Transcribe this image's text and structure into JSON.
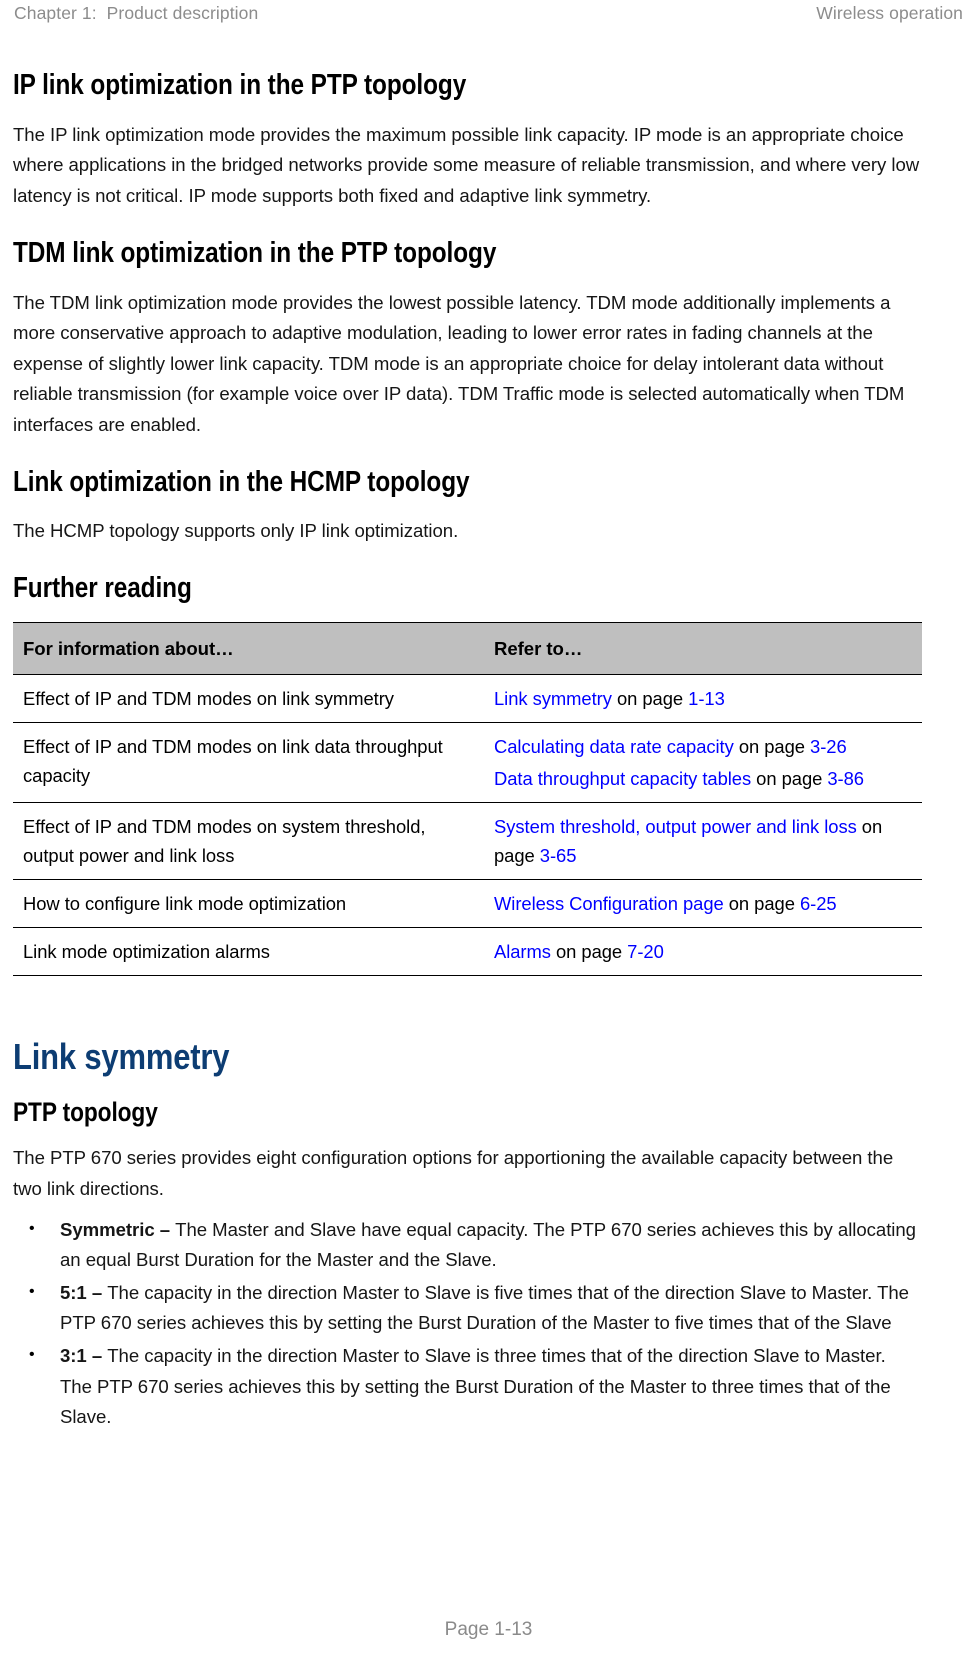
{
  "runhead": {
    "left": "Chapter 1:  Product description",
    "right": "Wireless operation"
  },
  "sections": {
    "ip": {
      "heading": "IP link optimization in the PTP topology",
      "body": "The IP link optimization mode provides the maximum possible link capacity. IP mode is an appropriate choice where applications in the bridged networks provide some measure of reliable transmission, and where very low latency is not critical. IP mode supports both fixed and adaptive link symmetry."
    },
    "tdm": {
      "heading": "TDM link optimization in the PTP topology",
      "body": "The TDM link optimization mode provides the lowest possible latency. TDM mode additionally implements a more conservative approach to adaptive modulation, leading to lower error rates in fading channels at the expense of slightly lower link capacity. TDM mode is an appropriate choice for delay intolerant data without reliable transmission (for example voice over IP data). TDM Traffic mode is selected automatically when TDM interfaces are enabled."
    },
    "hcmp": {
      "heading": "Link optimization in the HCMP topology",
      "body": "The HCMP topology supports only IP link optimization."
    },
    "further_reading": {
      "heading": "Further reading"
    },
    "link_symmetry": {
      "heading": "Link symmetry",
      "subheading": "PTP topology",
      "body": "The PTP 670 series provides eight configuration options for apportioning the available capacity between the two link directions."
    }
  },
  "table": {
    "columns": [
      "For information about…",
      "Refer to…"
    ],
    "rows": [
      {
        "about": "Effect of IP and TDM modes on link symmetry",
        "refs": [
          {
            "link": "Link symmetry",
            "connector": " on page ",
            "page": "1-13"
          }
        ]
      },
      {
        "about": "Effect of IP and TDM modes on link data throughput capacity",
        "refs": [
          {
            "link": "Calculating data rate capacity",
            "connector": " on page ",
            "page": "3-26"
          },
          {
            "link": "Data throughput capacity tables",
            "connector": " on page ",
            "page": "3-86"
          }
        ]
      },
      {
        "about": "Effect of IP and TDM modes on system threshold, output power and link loss",
        "refs": [
          {
            "link": "System threshold, output power and link loss",
            "connector": " on page ",
            "page": "3-65"
          }
        ]
      },
      {
        "about": "How to configure link mode optimization",
        "refs": [
          {
            "link": "Wireless Configuration page",
            "connector": " on page ",
            "page": "6-25"
          }
        ]
      },
      {
        "about": "Link mode optimization alarms",
        "refs": [
          {
            "link": "Alarms",
            "connector": " on page ",
            "page": "7-20"
          }
        ]
      }
    ]
  },
  "bullets": [
    {
      "term": "Symmetric",
      "dash": " – ",
      "text": "The Master and Slave have equal capacity. The PTP 670 series achieves this by allocating an equal Burst Duration for the Master and the Slave."
    },
    {
      "term": "5:1",
      "dash": " – ",
      "text": "The capacity in the direction Master to Slave is five times that of the direction Slave to Master. The PTP 670 series achieves this by setting the Burst Duration of the Master to five times that of the Slave"
    },
    {
      "term": "3:1",
      "dash": " – ",
      "text": "The capacity in the direction Master to Slave is three times that of the direction Slave to Master. The PTP 670 series achieves this by setting the Burst Duration of the Master to three times that of the Slave."
    }
  ],
  "footer": {
    "page_label": "Page 1-13"
  },
  "colors": {
    "link": "#0000ff",
    "section_heading": "#0d3d73",
    "table_header_bg": "#bfbfbf",
    "runhead_text": "#8c8c8c"
  }
}
